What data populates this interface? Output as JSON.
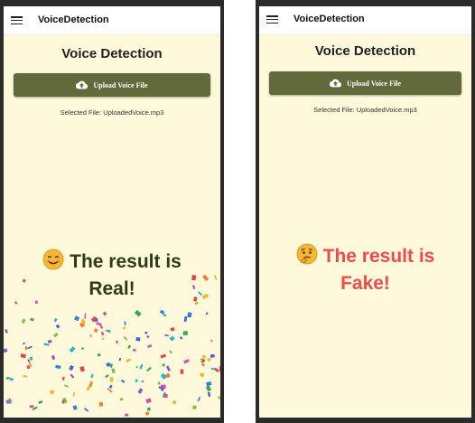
{
  "screens": [
    {
      "appbar_title": "VoiceDetection",
      "page_title": "Voice Detection",
      "upload_label": "Upload Voice File",
      "selected_file": "Selected File: UploadedVoice.mp3",
      "result_line1": "The result is",
      "result_line2": "Real!",
      "result_icon": "smiling-face-icon",
      "result_color": "#2e3a1a"
    },
    {
      "appbar_title": "VoiceDetection",
      "page_title": "Voice Detection",
      "upload_label": "Upload Voice File",
      "selected_file": "Selected File: UploadedVoice.mp3",
      "result_line1": "The result is",
      "result_line2": "Fake!",
      "result_icon": "thinking-face-icon",
      "result_color": "#ee4c4c"
    }
  ],
  "colors": {
    "background": "#fff9dc",
    "button": "#616a3b",
    "appbar": "#ffffff"
  }
}
